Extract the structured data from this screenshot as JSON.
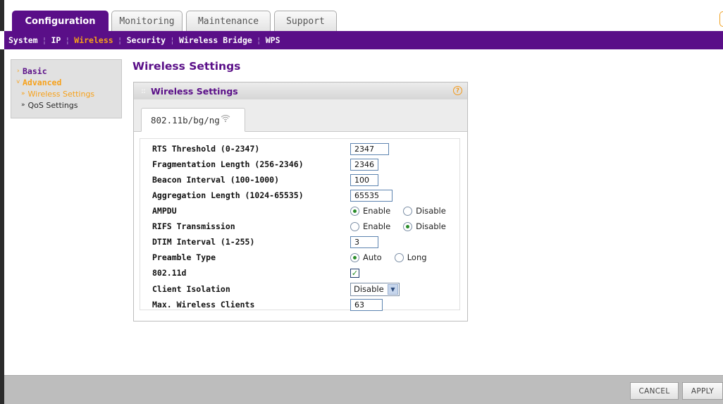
{
  "top_tabs": [
    {
      "label": "Configuration",
      "active": true
    },
    {
      "label": "Monitoring",
      "active": false
    },
    {
      "label": "Maintenance",
      "active": false
    },
    {
      "label": "Support",
      "active": false
    }
  ],
  "sub_nav": [
    "System",
    "IP",
    "Wireless",
    "Security",
    "Wireless Bridge",
    "WPS"
  ],
  "sub_nav_active": "Wireless",
  "left_menu": {
    "basic": "Basic",
    "advanced": "Advanced",
    "wireless_settings": "Wireless Settings",
    "qos_settings": "QoS Settings"
  },
  "page_title": "Wireless Settings",
  "panel": {
    "title": "Wireless Settings",
    "help": "?",
    "band_tab": "802.11b/bg/ng"
  },
  "fields": {
    "rts_label": "RTS Threshold (0-2347)",
    "rts_value": "2347",
    "frag_label": "Fragmentation Length (256-2346)",
    "frag_value": "2346",
    "beacon_label": "Beacon Interval (100-1000)",
    "beacon_value": "100",
    "agg_label": "Aggregation Length (1024-65535)",
    "agg_value": "65535",
    "ampdu_label": "AMPDU",
    "ampdu_opt1": "Enable",
    "ampdu_opt2": "Disable",
    "ampdu_selected": "Enable",
    "rifs_label": "RIFS Transmission",
    "rifs_opt1": "Enable",
    "rifs_opt2": "Disable",
    "rifs_selected": "Disable",
    "dtim_label": "DTIM Interval (1-255)",
    "dtim_value": "3",
    "preamble_label": "Preamble Type",
    "preamble_opt1": "Auto",
    "preamble_opt2": "Long",
    "preamble_selected": "Auto",
    "d80211_label": "802.11d",
    "d80211_checked": true,
    "isolation_label": "Client Isolation",
    "isolation_value": "Disable",
    "maxclients_label": "Max. Wireless Clients",
    "maxclients_value": "63"
  },
  "buttons": {
    "cancel": "CANCEL",
    "apply": "APPLY"
  },
  "colors": {
    "brand_purple": "#5a0f88",
    "accent_orange": "#f7a11a"
  },
  "icons": [
    "wifi-icon",
    "help-icon",
    "chevron-down-icon",
    "checkmark-icon"
  ]
}
